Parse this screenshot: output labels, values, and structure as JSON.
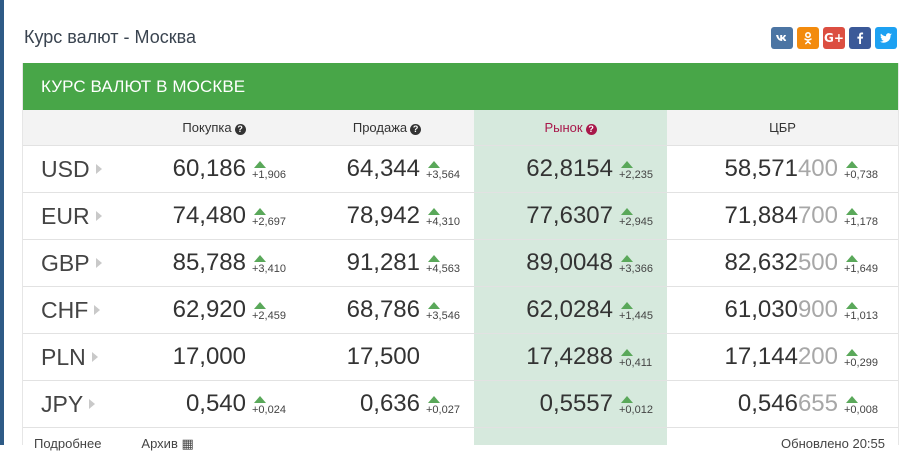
{
  "page_title": "Курс валют - Москва",
  "social": [
    {
      "name": "vk-icon",
      "label": "VK",
      "color": "#4c75a3"
    },
    {
      "name": "odnoklassniki-icon",
      "label": "OK",
      "color": "#f38b0d"
    },
    {
      "name": "google-plus-icon",
      "label": "G+",
      "color": "#dc4e41"
    },
    {
      "name": "facebook-icon",
      "label": "f",
      "color": "#3b5998"
    },
    {
      "name": "twitter-icon",
      "label": "t",
      "color": "#1da1f2"
    }
  ],
  "panel": {
    "title": "КУРС ВАЛЮТ В МОСКВЕ"
  },
  "columns": {
    "buy": "Покупка",
    "sell": "Продажа",
    "market": "Рынок",
    "cbr": "ЦБР"
  },
  "colors": {
    "accent_green": "#48a648",
    "market_bg": "#d6e9dd",
    "market_header": "#a8184a",
    "up_arrow": "#5aa85a"
  },
  "rows": [
    {
      "code": "USD",
      "buy": {
        "value": "60,186",
        "delta": "+1,906"
      },
      "sell": {
        "value": "64,344",
        "delta": "+3,564"
      },
      "market": {
        "value": "62,8154",
        "delta": "+2,235"
      },
      "cbr": {
        "value_main": "58,571",
        "value_dim": "400",
        "delta": "+0,738"
      }
    },
    {
      "code": "EUR",
      "buy": {
        "value": "74,480",
        "delta": "+2,697"
      },
      "sell": {
        "value": "78,942",
        "delta": "+4,310"
      },
      "market": {
        "value": "77,6307",
        "delta": "+2,945"
      },
      "cbr": {
        "value_main": "71,884",
        "value_dim": "700",
        "delta": "+1,178"
      }
    },
    {
      "code": "GBP",
      "buy": {
        "value": "85,788",
        "delta": "+3,410"
      },
      "sell": {
        "value": "91,281",
        "delta": "+4,563"
      },
      "market": {
        "value": "89,0048",
        "delta": "+3,366"
      },
      "cbr": {
        "value_main": "82,632",
        "value_dim": "500",
        "delta": "+1,649"
      }
    },
    {
      "code": "CHF",
      "buy": {
        "value": "62,920",
        "delta": "+2,459"
      },
      "sell": {
        "value": "68,786",
        "delta": "+3,546"
      },
      "market": {
        "value": "62,0284",
        "delta": "+1,445"
      },
      "cbr": {
        "value_main": "61,030",
        "value_dim": "900",
        "delta": "+1,013"
      }
    },
    {
      "code": "PLN",
      "buy": {
        "value": "17,000",
        "delta": ""
      },
      "sell": {
        "value": "17,500",
        "delta": ""
      },
      "market": {
        "value": "17,4288",
        "delta": "+0,411"
      },
      "cbr": {
        "value_main": "17,144",
        "value_dim": "200",
        "delta": "+0,299"
      }
    },
    {
      "code": "JPY",
      "buy": {
        "value": "0,540",
        "delta": "+0,024"
      },
      "sell": {
        "value": "0,636",
        "delta": "+0,027"
      },
      "market": {
        "value": "0,5557",
        "delta": "+0,012"
      },
      "cbr": {
        "value_main": "0,546",
        "value_dim": "655",
        "delta": "+0,008"
      }
    }
  ],
  "footer": {
    "more": "Подробнее",
    "archive": "Архив",
    "updated": "Обновлено 20:55"
  }
}
